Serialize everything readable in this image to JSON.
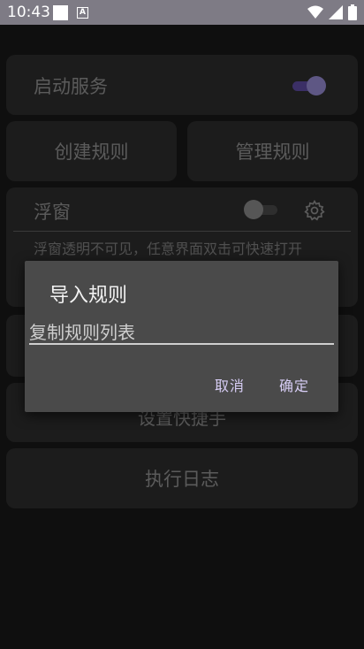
{
  "status_bar": {
    "time": "10:43",
    "a_icon": "A"
  },
  "main": {
    "start_service": {
      "label": "启动服务",
      "enabled": true
    },
    "create_rule": {
      "label": "创建规则"
    },
    "manage_rule": {
      "label": "管理规则"
    },
    "float_window": {
      "label": "浮窗",
      "enabled": false,
      "description": "浮窗透明不可见，任意界面双击可快速打开"
    },
    "hotkey": {
      "label": "设置快捷手"
    },
    "log": {
      "label": "执行日志"
    }
  },
  "dialog": {
    "title": "导入规则",
    "input_value": "复制规则列表",
    "cancel_label": "取消",
    "ok_label": "确定"
  },
  "colors": {
    "status_bar": "#7e7b85",
    "card": "#1c1c1c",
    "dialog": "#4a4a4a",
    "accent": "#d7cdf5"
  }
}
